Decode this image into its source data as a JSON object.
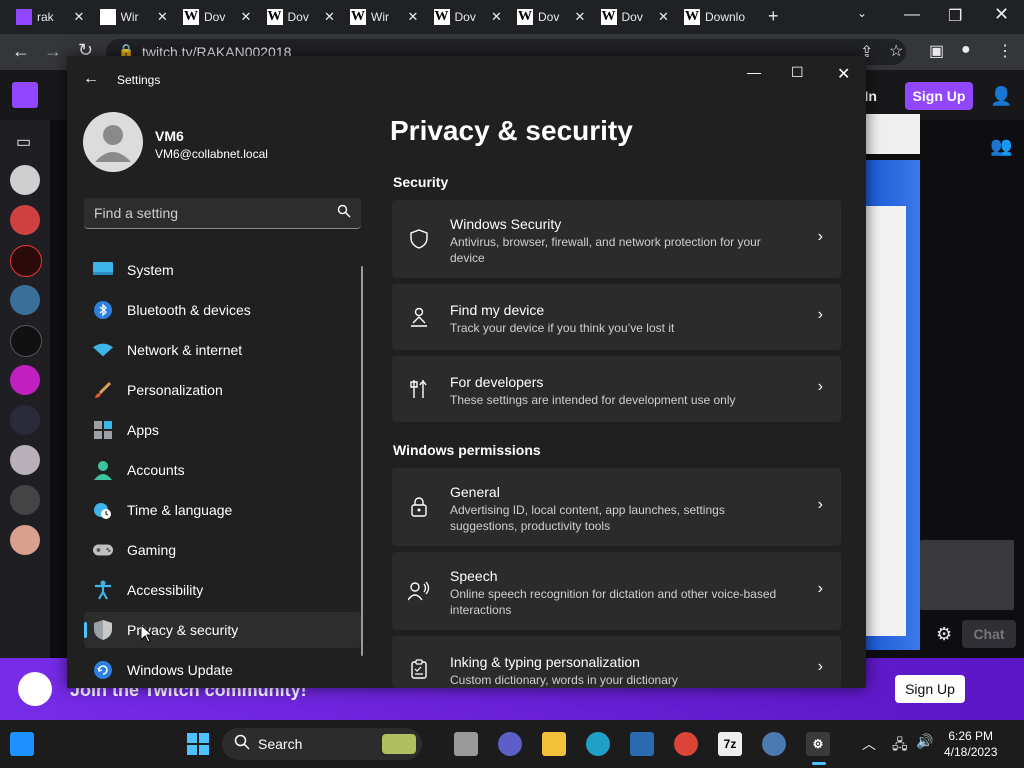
{
  "browser": {
    "tabs": [
      {
        "title": "rak",
        "fav": "tw"
      },
      {
        "title": "Wir",
        "fav": "rd"
      },
      {
        "title": "Dov",
        "fav": "w"
      },
      {
        "title": "Dov",
        "fav": "w"
      },
      {
        "title": "Wir",
        "fav": "w"
      },
      {
        "title": "Dov",
        "fav": "w"
      },
      {
        "title": "Dov",
        "fav": "w"
      },
      {
        "title": "Dov",
        "fav": "w"
      },
      {
        "title": "Downlo",
        "fav": "w"
      }
    ],
    "url": "twitch.tv/RAKAN002018"
  },
  "twitch": {
    "login": "g In",
    "signup": "Sign Up",
    "banner": "Join the Twitch community!",
    "banner_signup": "Sign Up",
    "chat": "Chat"
  },
  "settings": {
    "title": "Settings",
    "user_name": "VM6",
    "user_email": "VM6@collabnet.local",
    "search_placeholder": "Find a setting",
    "page_title": "Privacy & security",
    "nav": [
      {
        "label": "System",
        "icon": "monitor-icon"
      },
      {
        "label": "Bluetooth & devices",
        "icon": "bluetooth-icon"
      },
      {
        "label": "Network & internet",
        "icon": "wifi-icon"
      },
      {
        "label": "Personalization",
        "icon": "brush-icon"
      },
      {
        "label": "Apps",
        "icon": "apps-icon"
      },
      {
        "label": "Accounts",
        "icon": "person-icon"
      },
      {
        "label": "Time & language",
        "icon": "clock-globe-icon"
      },
      {
        "label": "Gaming",
        "icon": "gamepad-icon"
      },
      {
        "label": "Accessibility",
        "icon": "accessibility-icon"
      },
      {
        "label": "Privacy & security",
        "icon": "shield-icon",
        "selected": true
      },
      {
        "label": "Windows Update",
        "icon": "update-icon"
      }
    ],
    "sections": {
      "security": "Security",
      "permissions": "Windows permissions"
    },
    "security_cards": [
      {
        "title": "Windows Security",
        "desc": "Antivirus, browser, firewall, and network protection for your device",
        "icon": "shield-outline-icon"
      },
      {
        "title": "Find my device",
        "desc": "Track your device if you think you’ve lost it",
        "icon": "person-location-icon"
      },
      {
        "title": "For developers",
        "desc": "These settings are intended for development use only",
        "icon": "tools-icon"
      }
    ],
    "permission_cards": [
      {
        "title": "General",
        "desc": "Advertising ID, local content, app launches, settings suggestions, productivity tools",
        "icon": "lock-icon"
      },
      {
        "title": "Speech",
        "desc": "Online speech recognition for dictation and other voice-based interactions",
        "icon": "speech-icon"
      },
      {
        "title": "Inking & typing personalization",
        "desc": "Custom dictionary, words in your dictionary",
        "icon": "clipboard-icon"
      }
    ]
  },
  "taskbar": {
    "search": "Search",
    "time": "6:26 PM",
    "date": "4/18/2023"
  },
  "colors": {
    "twitch_purple": "#9147ff",
    "accent": "#4cc2ff",
    "window_bg": "#202020",
    "card_bg": "#2b2b2b"
  }
}
